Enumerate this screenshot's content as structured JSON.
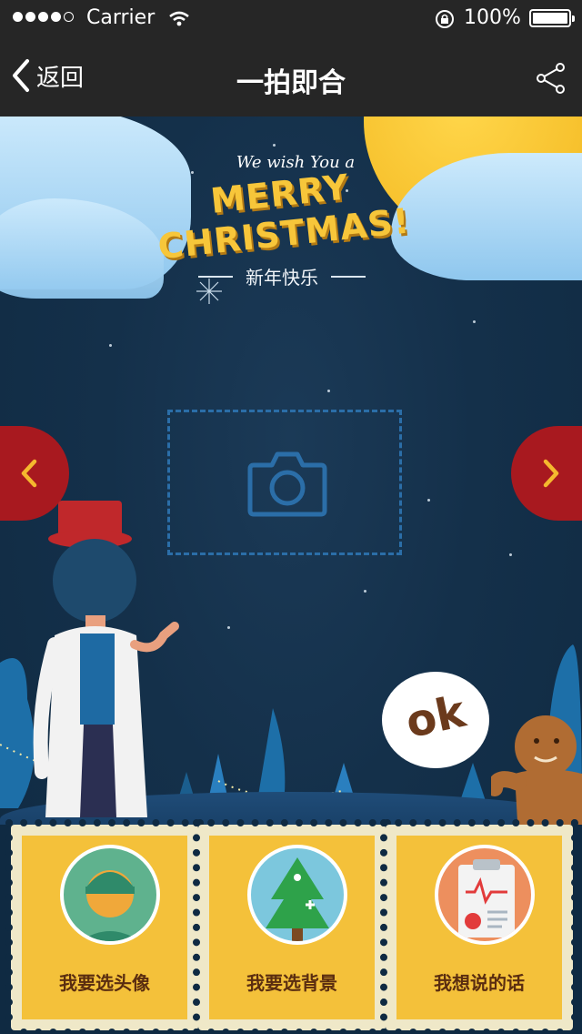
{
  "status_bar": {
    "carrier": "Carrier",
    "battery": "100%"
  },
  "nav": {
    "back_label": "返回",
    "title": "一拍即合"
  },
  "greeting": {
    "wish": "We wish You a",
    "merry": "MERRY CHRISTMAS!",
    "new_year": "新年快乐"
  },
  "ok_label": "ok",
  "stamps": [
    {
      "label": "我要选头像"
    },
    {
      "label": "我要选背景"
    },
    {
      "label": "我想说的话"
    }
  ],
  "colors": {
    "bar_bg": "#262626",
    "scene_bg": "#14304a",
    "arrow_red": "#a8191f",
    "stamp_yellow": "#f4c13a",
    "stamp_text": "#5a2d10"
  }
}
